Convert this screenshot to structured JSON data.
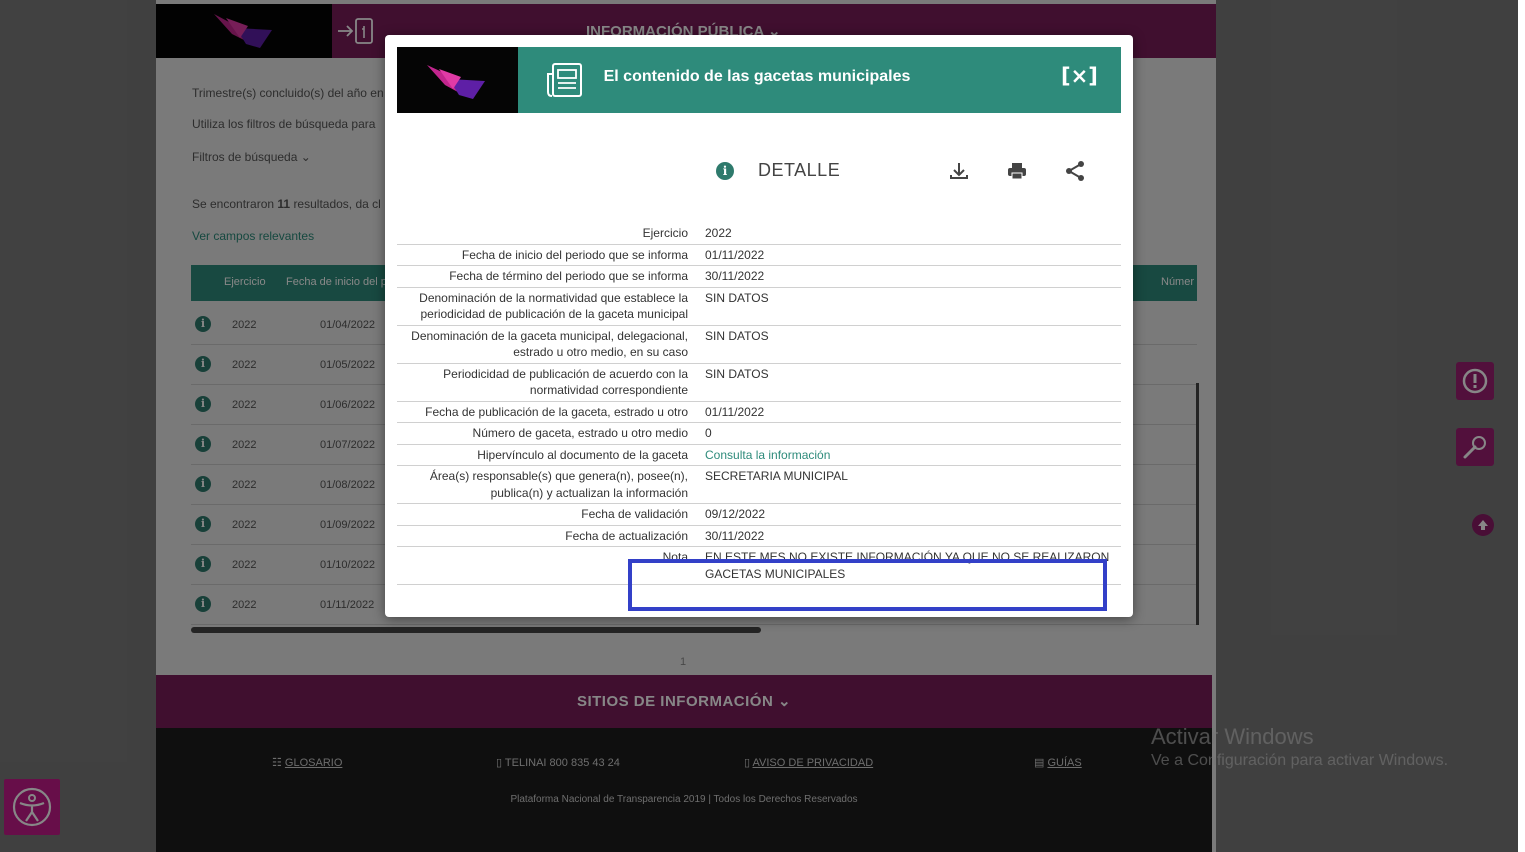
{
  "background": {
    "header_menu": "INFORMACIÓN PÚBLICA",
    "intro_line1": "Trimestre(s) concluido(s) del año en",
    "intro_line2": "Utiliza los filtros de búsqueda para",
    "filters_label": "Filtros de búsqueda",
    "results_pre": "Se encontraron",
    "results_count": "11",
    "results_post": "resultados, da cl",
    "relevant_link": "Ver campos relevantes",
    "table_headers": {
      "ejercicio": "Ejercicio",
      "fecha_inicio": "Fecha de inicio del p",
      "numero": "Númer"
    },
    "rows": [
      {
        "year": "2022",
        "date": "01/04/2022"
      },
      {
        "year": "2022",
        "date": "01/05/2022"
      },
      {
        "year": "2022",
        "date": "01/06/2022"
      },
      {
        "year": "2022",
        "date": "01/07/2022"
      },
      {
        "year": "2022",
        "date": "01/08/2022"
      },
      {
        "year": "2022",
        "date": "01/09/2022"
      },
      {
        "year": "2022",
        "date": "01/10/2022"
      },
      {
        "year": "2022",
        "date": "01/11/2022"
      }
    ],
    "page_number": "1",
    "sites_label": "SITIOS DE INFORMACIÓN",
    "footer": {
      "glosario": "GLOSARIO",
      "telinai": "TELINAI 800 835 43 24",
      "aviso": "AVISO DE PRIVACIDAD",
      "guias": "GUÍAS",
      "copyright": "Plataforma Nacional de Transparencia 2019 | Todos los Derechos Reservados"
    }
  },
  "watermark": {
    "line1": "Activar Windows",
    "line2": "Ve a Configuración para activar Windows."
  },
  "modal": {
    "title": "El contenido de las gacetas municipales",
    "close_label": "[×]",
    "detail_label": "DETALLE",
    "fields": [
      {
        "label": "Ejercicio",
        "value": "2022"
      },
      {
        "label": "Fecha de inicio del periodo que se informa",
        "value": "01/11/2022"
      },
      {
        "label": "Fecha de término del periodo que se informa",
        "value": "30/11/2022"
      },
      {
        "label": "Denominación de la normatividad que establece la periodicidad de publicación de la gaceta municipal",
        "value": "SIN DATOS"
      },
      {
        "label": "Denominación de la gaceta municipal, delegacional, estrado u otro medio, en su caso",
        "value": "SIN DATOS"
      },
      {
        "label": "Periodicidad de publicación de acuerdo con la normatividad correspondiente",
        "value": "SIN DATOS"
      },
      {
        "label": "Fecha de publicación de la gaceta, estrado u otro",
        "value": "01/11/2022"
      },
      {
        "label": "Número de gaceta, estrado u otro medio",
        "value": "0"
      },
      {
        "label": "Hipervínculo al documento de la gaceta",
        "value": "Consulta la información"
      },
      {
        "label": "Área(s) responsable(s) que genera(n), posee(n), publica(n) y actualizan la información",
        "value": "SECRETARIA MUNICIPAL"
      },
      {
        "label": "Fecha de validación",
        "value": "09/12/2022"
      },
      {
        "label": "Fecha de actualización",
        "value": "30/11/2022"
      },
      {
        "label": "Nota",
        "value": "EN ESTE MES NO EXISTE INFORMACIÓN YA QUE NO SE REALIZARON GACETAS MUNICIPALES"
      }
    ]
  },
  "colors": {
    "teal": "#2e8b7b",
    "magenta": "#7a1d5a",
    "highlight": "#3340c8"
  }
}
